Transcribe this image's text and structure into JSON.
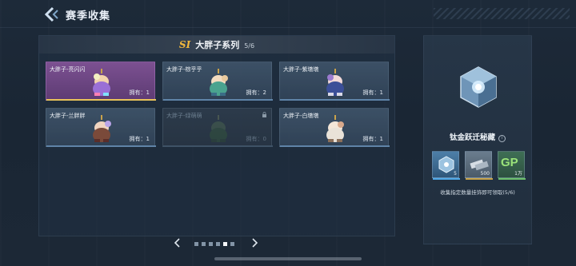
{
  "header": {
    "title": "赛季收集"
  },
  "series": {
    "badge": "SI",
    "title": "大胖子系列",
    "count": "5/6"
  },
  "cards": [
    {
      "name": "大胖子-亮闪闪",
      "owned": "拥有：1",
      "state": "special"
    },
    {
      "name": "大胖子-棕乎乎",
      "owned": "拥有：2",
      "state": "normal"
    },
    {
      "name": "大胖子-紫墩墩",
      "owned": "拥有：1",
      "state": "normal"
    },
    {
      "name": "大胖子-兰胖胖",
      "owned": "拥有：1",
      "state": "normal"
    },
    {
      "name": "大胖子-绿萌萌",
      "owned": "拥有：0",
      "state": "locked"
    },
    {
      "name": "大胖子-白墩墩",
      "owned": "拥有：1",
      "state": "normal"
    }
  ],
  "pager": {
    "total": 6,
    "active_index": 4
  },
  "reward": {
    "title": "钛金跃迁秘藏",
    "info_icon": "i",
    "items": [
      {
        "icon": "titanium-crate-icon",
        "count": "5"
      },
      {
        "icon": "material-chips-icon",
        "count": "500"
      },
      {
        "icon": "gp-currency-icon",
        "label": "GP",
        "count": "1万"
      }
    ],
    "description": "收集指定数量挂饰即可领取(5/6)"
  },
  "colors": {
    "accent_gold": "#f0b73c",
    "special_card": "#8c56a0",
    "card_base": "#465c73"
  }
}
